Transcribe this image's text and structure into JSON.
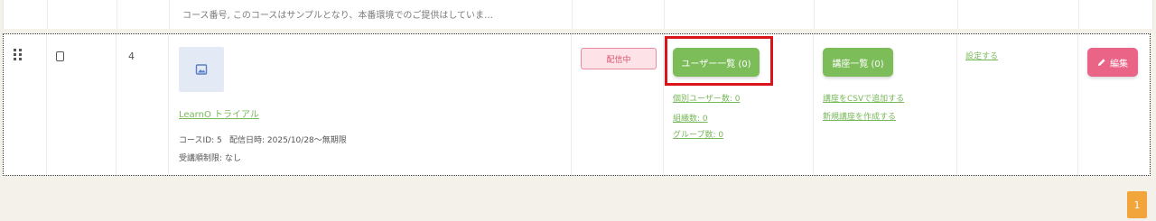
{
  "top_note": "コース番号, このコースはサンプルとなり、本番環境でのご提供はしていま…",
  "row": {
    "number": "4",
    "course_name": "LearnO トライアル",
    "course_id": "コースID: 5",
    "delivery_date": "配信日時: 2025/10/28〜無期限",
    "attendance_limit": "受講順制限: なし",
    "status": "配信中",
    "users_button": "ユーザー一覧 (0)",
    "individual_users": "個別ユーザー数: 0",
    "organizations": "組織数: 0",
    "groups": "グループ数: 0",
    "courses_button": "講座一覧 (0)",
    "add_csv": "講座をCSVで追加する",
    "create_course": "新規講座を作成する",
    "settings_link": "設定する",
    "edit_button": "編集"
  },
  "pagination": {
    "current_page": "1"
  },
  "colors": {
    "accent_green": "#7cbd5a",
    "edit_pink": "#e96487",
    "status_pink": "#d9536f",
    "highlight_red": "#d9141b",
    "page_orange": "#f2a53a"
  }
}
